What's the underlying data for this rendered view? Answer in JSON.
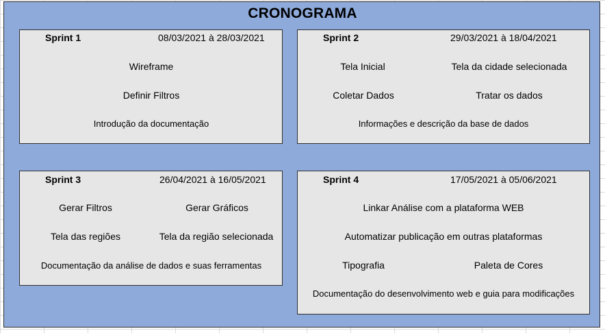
{
  "title": "CRONOGRAMA",
  "sprints": [
    {
      "name": "Sprint 1",
      "dates": "08/03/2021 à 28/03/2021",
      "tasks": [
        "Wireframe",
        "Definir Filtros",
        "Introdução da documentação"
      ]
    },
    {
      "name": "Sprint 2",
      "dates": "29/03/2021 à 18/04/2021",
      "tasks": [
        "Tela Inicial",
        "Tela da cidade selecionada",
        "Coletar Dados",
        "Tratar os dados",
        "Informações e descrição da base de dados"
      ]
    },
    {
      "name": "Sprint 3",
      "dates": "26/04/2021 à 16/05/2021",
      "tasks": [
        "Gerar Filtros",
        "Gerar Gráficos",
        "Tela das regiões",
        "Tela da região selecionada",
        "Documentação da análise de dados e suas ferramentas"
      ]
    },
    {
      "name": "Sprint 4",
      "dates": "17/05/2021 à 05/06/2021",
      "tasks": [
        "Linkar Análise com a plataforma WEB",
        "Automatizar publicação em outras plataformas",
        "Tipografia",
        "Paleta de Cores",
        "Documentação do desenvolvimento web e guia para modificações"
      ]
    }
  ]
}
